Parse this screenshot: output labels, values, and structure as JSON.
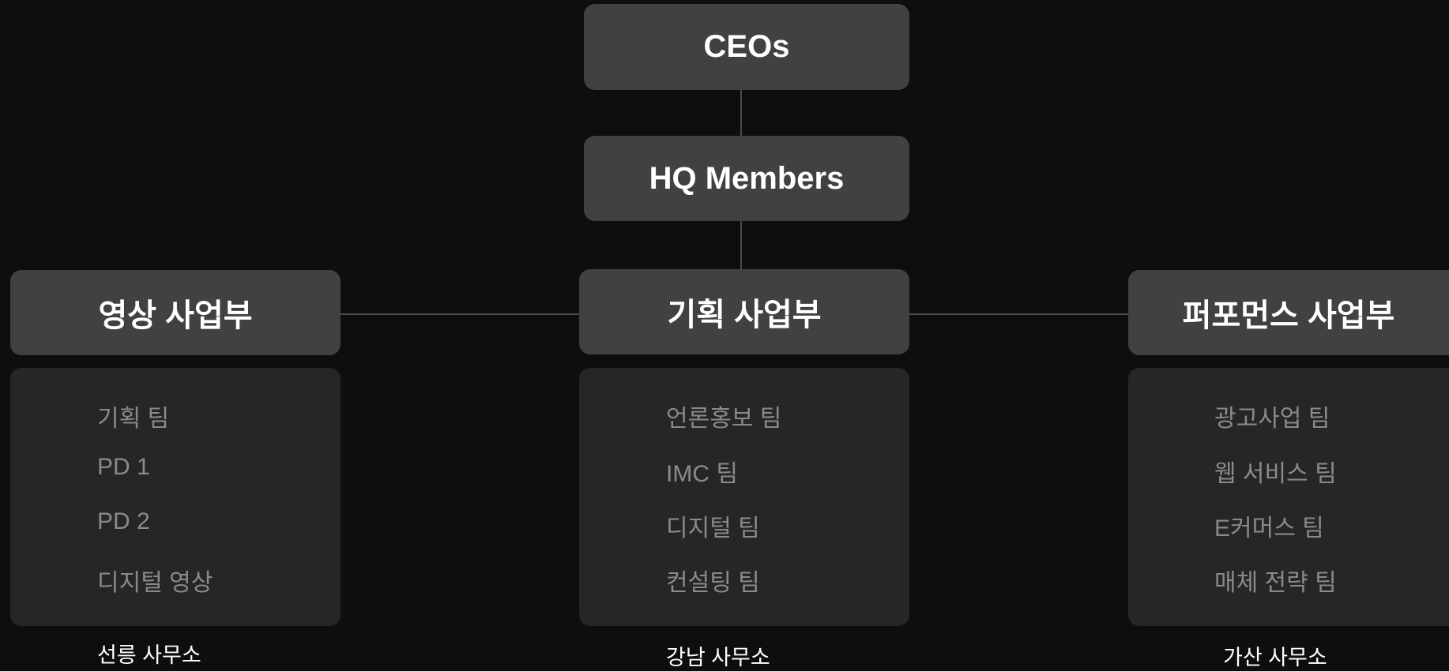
{
  "top": {
    "ceo": "CEOs",
    "hq": "HQ Members"
  },
  "divisions": [
    {
      "name": "영상 사업부",
      "teams": [
        "기획 팀",
        "PD 1",
        "PD 2",
        "디지털 영상"
      ],
      "office": "선릉 사무소"
    },
    {
      "name": "기획 사업부",
      "teams": [
        "언론홍보 팀",
        "IMC 팀",
        "디지털 팀",
        "컨설팅 팀"
      ],
      "office": "강남 사무소"
    },
    {
      "name": "퍼포먼스 사업부",
      "teams": [
        "광고사업 팀",
        "웹 서비스 팀",
        "E커머스 팀",
        "매체 전략 팀"
      ],
      "office": "가산 사무소"
    }
  ],
  "colors": {
    "background": "#0e0e0e",
    "node": "#414141",
    "panel": "#262626",
    "team_text": "#8a8a8a",
    "line": "#4a4a4a"
  }
}
